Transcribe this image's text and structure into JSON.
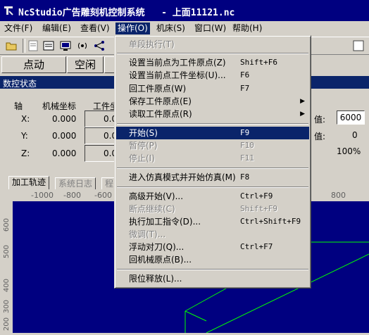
{
  "window": {
    "title": "NcStudio广告雕刻机控制系统   - 上面11121.nc"
  },
  "menubar": {
    "items": [
      {
        "label": "文件(F)"
      },
      {
        "label": "编辑(E)"
      },
      {
        "label": "查看(V)"
      },
      {
        "label": "操作(O)"
      },
      {
        "label": "机床(S)"
      },
      {
        "label": "窗口(W)"
      },
      {
        "label": "帮助(H)"
      }
    ]
  },
  "modes": {
    "auto": "点动",
    "idle": "空闲"
  },
  "status": {
    "header": "数控状态",
    "axis_col": "轴",
    "machine_col": "机械坐标",
    "work_col": "工件坐",
    "rows": [
      {
        "axis": "X:",
        "machine": "0.000",
        "work": "0.0"
      },
      {
        "axis": "Y:",
        "machine": "0.000",
        "work": "0.0"
      },
      {
        "axis": "Z:",
        "machine": "0.000",
        "work": "0.0"
      }
    ],
    "right_lbl1": "值:",
    "right_val1": "6000",
    "right_lbl2": "值:",
    "right_val2": "0",
    "percent": "100%"
  },
  "tabs": [
    {
      "label": "加工轨迹"
    },
    {
      "label": "系统日志"
    },
    {
      "label": "程"
    }
  ],
  "ruler": {
    "top": [
      "-1000",
      "-800",
      "-600",
      "800"
    ],
    "left": [
      "600",
      "500",
      "400",
      "300",
      "200"
    ]
  },
  "dropdown": {
    "items": [
      {
        "label": "单段执行(T)",
        "shortcut": "",
        "disabled": true
      },
      {
        "label": "设置当前点为工件原点(Z)",
        "shortcut": "Shift+F6"
      },
      {
        "label": "设置当前点工件坐标(U)...",
        "shortcut": "F6"
      },
      {
        "label": "回工件原点(W)",
        "shortcut": "F7"
      },
      {
        "label": "保存工件原点(E)",
        "shortcut": "",
        "submenu": true
      },
      {
        "label": "读取工件原点(R)",
        "shortcut": "",
        "submenu": true
      },
      {
        "label": "开始(S)",
        "shortcut": "F9",
        "highlight": true
      },
      {
        "label": "暂停(P)",
        "shortcut": "F10",
        "disabled": true
      },
      {
        "label": "停止(I)",
        "shortcut": "F11",
        "disabled": true
      },
      {
        "label": "进入仿真模式并开始仿真(M)",
        "shortcut": "F8"
      },
      {
        "label": "高级开始(V)...",
        "shortcut": "Ctrl+F9"
      },
      {
        "label": "断点继续(C)",
        "shortcut": "Shift+F9",
        "disabled": true
      },
      {
        "label": "执行加工指令(D)...",
        "shortcut": "Ctrl+Shift+F9"
      },
      {
        "label": "微调(T)...",
        "shortcut": "",
        "disabled": true
      },
      {
        "label": "浮动对刀(Q)...",
        "shortcut": "Ctrl+F7"
      },
      {
        "label": "回机械原点(B)...",
        "shortcut": ""
      },
      {
        "label": "限位释放(L)...",
        "shortcut": ""
      }
    ]
  },
  "colors": {
    "accent": "#0a246a",
    "canvas": "#000080",
    "path": "#00ff00"
  }
}
